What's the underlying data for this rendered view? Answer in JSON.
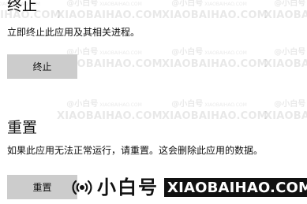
{
  "terminate": {
    "title": "终止",
    "description": "立即终止此应用及其相关进程。",
    "button_label": "终止"
  },
  "reset": {
    "title": "重置",
    "description": "如果此应用无法正常运行，请重置。这会删除此应用的数据。",
    "button_label": "重置"
  },
  "watermark": {
    "top_text": "@小白号",
    "small_text": "XIAOBAIHAO.COM",
    "bottom_text": "XIAOBAIHAO.COM"
  },
  "brand": {
    "icon": "signal-icon",
    "name": "小白号",
    "domain": "XIAOBAIHAO.COM"
  }
}
